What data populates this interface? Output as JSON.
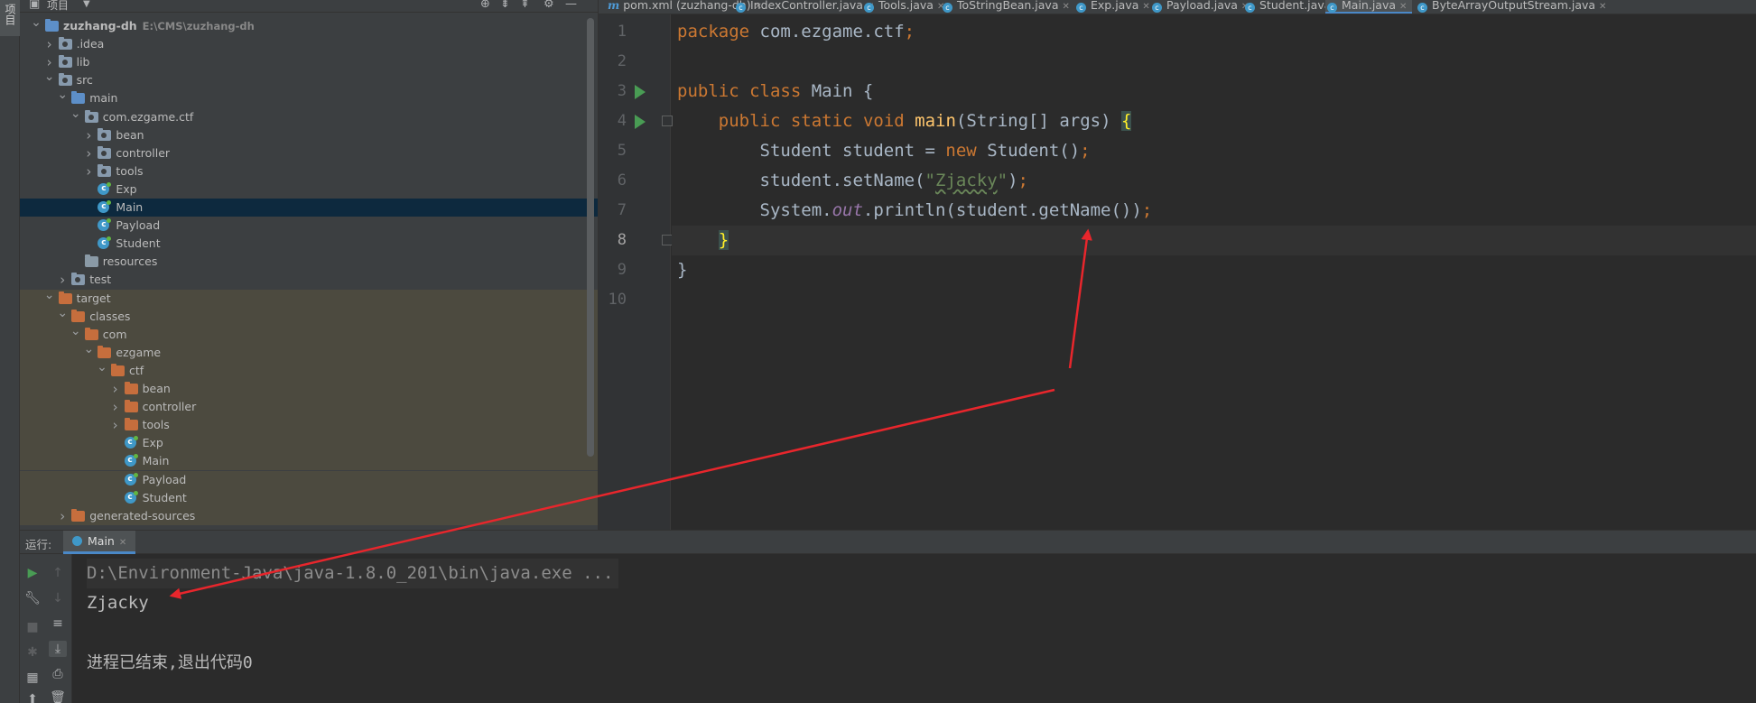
{
  "project": {
    "header_label": "项目",
    "vertical_tab": "项目",
    "tree": [
      {
        "depth": 0,
        "arrow": "open",
        "icon": "module",
        "label": "zuzhang-dh",
        "sub": "E:\\CMS\\zuzhang-dh",
        "bold": true,
        "bg": ""
      },
      {
        "depth": 1,
        "arrow": "closed",
        "icon": "folder",
        "label": ".idea",
        "bg": ""
      },
      {
        "depth": 1,
        "arrow": "closed",
        "icon": "folder",
        "label": "lib",
        "bg": ""
      },
      {
        "depth": 1,
        "arrow": "open",
        "icon": "folder",
        "label": "src",
        "bg": ""
      },
      {
        "depth": 2,
        "arrow": "open",
        "icon": "folder-blue",
        "label": "main",
        "bg": ""
      },
      {
        "depth": 3,
        "arrow": "open",
        "icon": "package",
        "label": "com.ezgame.ctf",
        "bg": ""
      },
      {
        "depth": 4,
        "arrow": "closed",
        "icon": "package",
        "label": "bean",
        "bg": ""
      },
      {
        "depth": 4,
        "arrow": "closed",
        "icon": "package",
        "label": "controller",
        "bg": ""
      },
      {
        "depth": 4,
        "arrow": "closed",
        "icon": "package",
        "label": "tools",
        "bg": ""
      },
      {
        "depth": 4,
        "arrow": "",
        "icon": "class",
        "label": "Exp",
        "bg": ""
      },
      {
        "depth": 4,
        "arrow": "",
        "icon": "class",
        "label": "Main",
        "bg": "selected"
      },
      {
        "depth": 4,
        "arrow": "",
        "icon": "class",
        "label": "Payload",
        "bg": ""
      },
      {
        "depth": 4,
        "arrow": "",
        "icon": "class",
        "label": "Student",
        "bg": ""
      },
      {
        "depth": 3,
        "arrow": "",
        "icon": "resources",
        "label": "resources",
        "bg": ""
      },
      {
        "depth": 2,
        "arrow": "closed",
        "icon": "folder",
        "label": "test",
        "bg": ""
      },
      {
        "depth": 1,
        "arrow": "open",
        "icon": "folder-orange",
        "label": "target",
        "bg": "target"
      },
      {
        "depth": 2,
        "arrow": "open",
        "icon": "folder-orange",
        "label": "classes",
        "bg": "target"
      },
      {
        "depth": 3,
        "arrow": "open",
        "icon": "folder-orange",
        "label": "com",
        "bg": "target"
      },
      {
        "depth": 4,
        "arrow": "open",
        "icon": "folder-orange",
        "label": "ezgame",
        "bg": "target"
      },
      {
        "depth": 5,
        "arrow": "open",
        "icon": "folder-orange",
        "label": "ctf",
        "bg": "target"
      },
      {
        "depth": 6,
        "arrow": "closed",
        "icon": "folder-orange",
        "label": "bean",
        "bg": "target"
      },
      {
        "depth": 6,
        "arrow": "closed",
        "icon": "folder-orange",
        "label": "controller",
        "bg": "target"
      },
      {
        "depth": 6,
        "arrow": "closed",
        "icon": "folder-orange",
        "label": "tools",
        "bg": "target"
      },
      {
        "depth": 6,
        "arrow": "",
        "icon": "class",
        "label": "Exp",
        "bg": "target"
      },
      {
        "depth": 6,
        "arrow": "",
        "icon": "class",
        "label": "Main",
        "bg": "target"
      },
      {
        "depth": 6,
        "arrow": "",
        "icon": "class",
        "label": "Payload",
        "bg": "target"
      },
      {
        "depth": 6,
        "arrow": "",
        "icon": "class",
        "label": "Student",
        "bg": "target"
      },
      {
        "depth": 2,
        "arrow": "closed",
        "icon": "folder-orange",
        "label": "generated-sources",
        "bg": "target"
      }
    ]
  },
  "tabs": [
    {
      "label": "pom.xml (zuzhang-dh)",
      "icon": "maven",
      "active": false
    },
    {
      "label": "IndexController.java",
      "icon": "class",
      "active": false
    },
    {
      "label": "Tools.java",
      "icon": "class",
      "active": false
    },
    {
      "label": "ToStringBean.java",
      "icon": "class",
      "active": false
    },
    {
      "label": "Exp.java",
      "icon": "class",
      "active": false
    },
    {
      "label": "Payload.java",
      "icon": "class",
      "active": false
    },
    {
      "label": "Student.java",
      "icon": "class",
      "active": false
    },
    {
      "label": "Main.java",
      "icon": "class",
      "active": true
    },
    {
      "label": "ByteArrayOutputStream.java",
      "icon": "class",
      "active": false
    }
  ],
  "editor": {
    "line_numbers": [
      "1",
      "2",
      "3",
      "4",
      "5",
      "6",
      "7",
      "8",
      "9",
      "10"
    ],
    "current_line": 8,
    "run_gutter_lines": [
      3,
      4
    ],
    "fold_lines": [
      4,
      8
    ],
    "lines": [
      [
        {
          "t": "package",
          "c": "kw"
        },
        {
          "t": " com.ezgame.ctf",
          "c": ""
        },
        {
          "t": ";",
          "c": "kw"
        }
      ],
      [],
      [
        {
          "t": "public",
          "c": "kw"
        },
        {
          "t": " ",
          "c": ""
        },
        {
          "t": "class",
          "c": "kw"
        },
        {
          "t": " Main {",
          "c": ""
        }
      ],
      [
        {
          "t": "    ",
          "c": ""
        },
        {
          "t": "public",
          "c": "kw"
        },
        {
          "t": " ",
          "c": ""
        },
        {
          "t": "static",
          "c": "kw"
        },
        {
          "t": " ",
          "c": ""
        },
        {
          "t": "void",
          "c": "kw"
        },
        {
          "t": " ",
          "c": ""
        },
        {
          "t": "main",
          "c": "fn"
        },
        {
          "t": "(String[] args) ",
          "c": ""
        },
        {
          "t": "{",
          "c": "br-match"
        }
      ],
      [
        {
          "t": "        Student student = ",
          "c": ""
        },
        {
          "t": "new",
          "c": "kw"
        },
        {
          "t": " Student()",
          "c": ""
        },
        {
          "t": ";",
          "c": "kw"
        }
      ],
      [
        {
          "t": "        student.setName(",
          "c": ""
        },
        {
          "t": "\"",
          "c": "st"
        },
        {
          "t": "Zjacky",
          "c": "st typo"
        },
        {
          "t": "\"",
          "c": "st"
        },
        {
          "t": ")",
          "c": ""
        },
        {
          "t": ";",
          "c": "kw"
        }
      ],
      [
        {
          "t": "        System.",
          "c": ""
        },
        {
          "t": "out",
          "c": "sf"
        },
        {
          "t": ".println(student.getName())",
          "c": ""
        },
        {
          "t": ";",
          "c": "kw"
        }
      ],
      [
        {
          "t": "    ",
          "c": ""
        },
        {
          "t": "}",
          "c": "br-match"
        }
      ],
      [
        {
          "t": "}",
          "c": ""
        }
      ],
      []
    ]
  },
  "run": {
    "title": "运行:",
    "tab_label": "Main",
    "console": {
      "command": "D:\\Environment-Java\\java-1.8.0_201\\bin\\java.exe ...",
      "output": "Zjacky",
      "exit": "进程已结束,退出代码0"
    }
  },
  "colors": {
    "annotation_arrow": "#e8262c",
    "accent": "#4a88c7"
  }
}
